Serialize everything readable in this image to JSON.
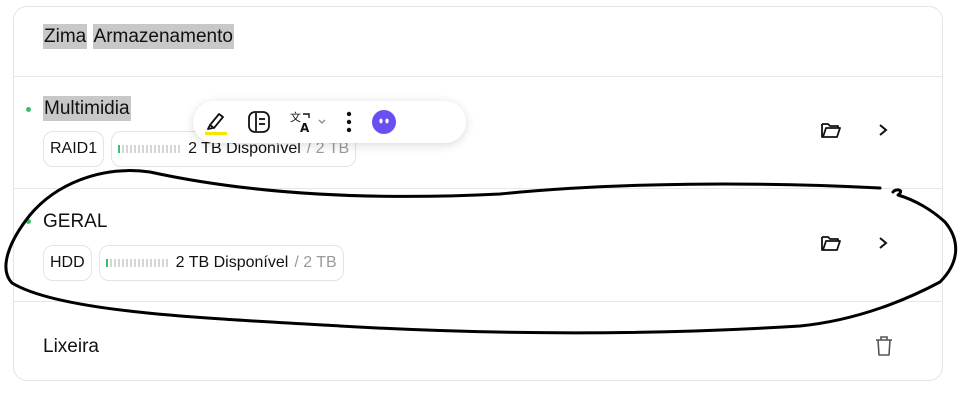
{
  "section": {
    "title_part1": "Zima",
    "title_part2": "Armazenamento"
  },
  "rows": [
    {
      "name": "Multimidia",
      "type": "RAID1",
      "available": "2 TB Disponível",
      "total": "/ 2 TB"
    },
    {
      "name": "GERAL",
      "type": "HDD",
      "available": "2 TB Disponível",
      "total": "/ 2 TB"
    }
  ],
  "trash": {
    "label": "Lixeira"
  },
  "icons": {
    "folder": "folder-open-icon",
    "chevron": "chevron-right-icon",
    "trash": "trash-icon",
    "highlighter": "highlighter-icon",
    "reader": "reader-view-icon",
    "translate": "translate-icon",
    "more": "more-vertical-icon",
    "assistant": "assistant-face-icon"
  },
  "colors": {
    "status_green": "#3bbf6b",
    "highlight_gray": "#c8c8c8",
    "assistant_purple": "#6b4ef0",
    "highlighter_yellow": "#f5e500",
    "ink": "#000000"
  }
}
